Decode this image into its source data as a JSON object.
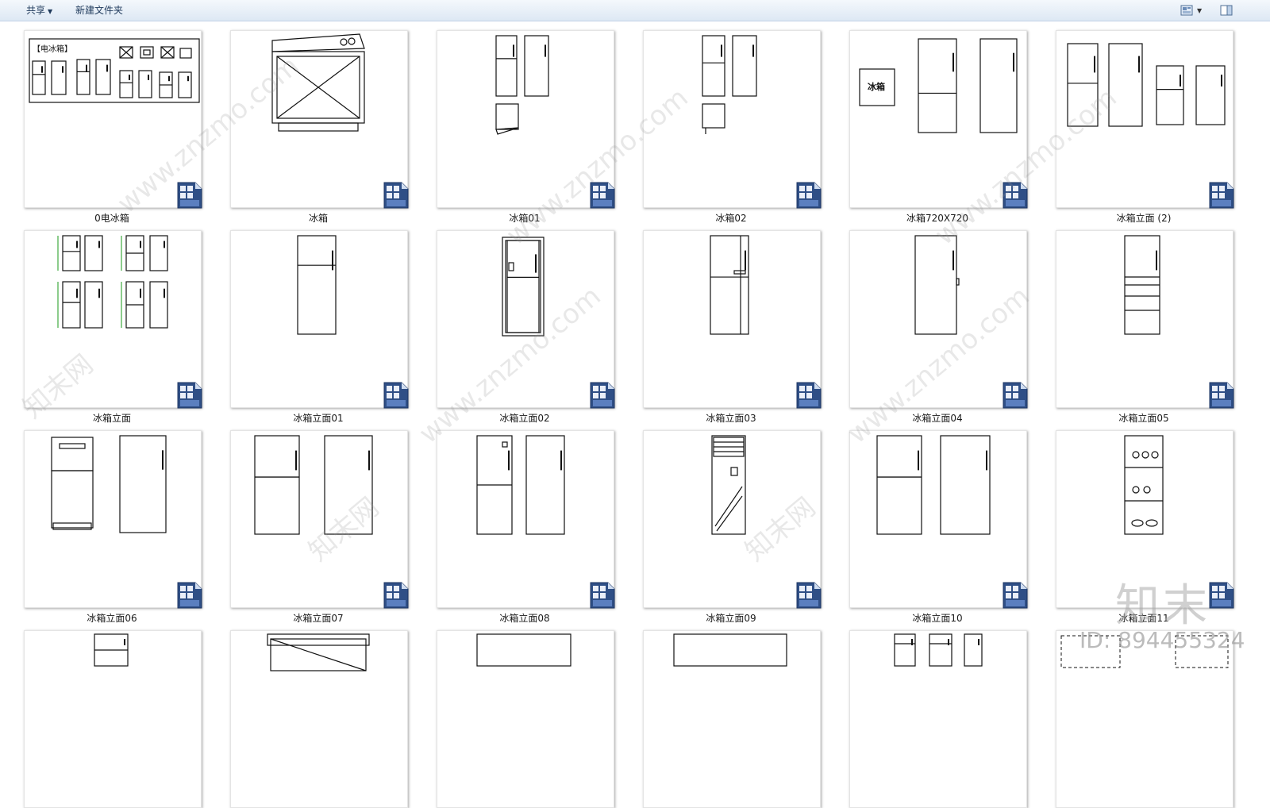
{
  "toolbar": {
    "share_label": "共享",
    "new_folder_label": "新建文件夹",
    "view_icon": "view-options-icon",
    "preview_icon": "preview-pane-icon"
  },
  "files": [
    {
      "name": "0电冰箱"
    },
    {
      "name": "冰箱"
    },
    {
      "name": "冰箱01"
    },
    {
      "name": "冰箱02"
    },
    {
      "name": "冰箱720X720"
    },
    {
      "name": "冰箱立面 (2)"
    },
    {
      "name": "冰箱立面"
    },
    {
      "name": "冰箱立面01"
    },
    {
      "name": "冰箱立面02"
    },
    {
      "name": "冰箱立面03"
    },
    {
      "name": "冰箱立面04"
    },
    {
      "name": "冰箱立面05"
    },
    {
      "name": "冰箱立面06"
    },
    {
      "name": "冰箱立面07"
    },
    {
      "name": "冰箱立面08"
    },
    {
      "name": "冰箱立面09"
    },
    {
      "name": "冰箱立面10"
    },
    {
      "name": "冰箱立面11"
    },
    {
      "name": ""
    },
    {
      "name": ""
    },
    {
      "name": ""
    },
    {
      "name": ""
    },
    {
      "name": ""
    },
    {
      "name": ""
    }
  ],
  "thumb_texts": {
    "electric_fridge_header": "【电冰箱】",
    "fridge_box": "冰箱"
  },
  "watermark": {
    "site": "www.znzmo.com",
    "brand": "知末网",
    "logo": "知末",
    "id": "ID: 894455324"
  }
}
